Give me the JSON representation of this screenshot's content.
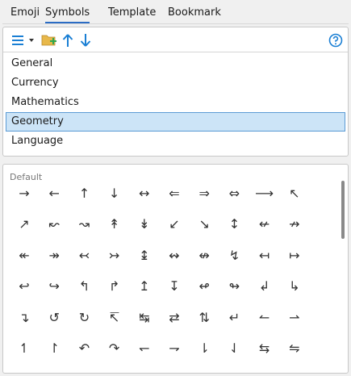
{
  "tabs": [
    {
      "label": "Emoji",
      "active": false
    },
    {
      "label": "Symbols",
      "active": true
    },
    {
      "label": "Template",
      "active": false
    },
    {
      "label": "Bookmark",
      "active": false
    }
  ],
  "toolbar": {
    "icons": [
      "list-menu-icon",
      "dropdown-arrow-icon",
      "add-folder-icon",
      "arrow-up-icon",
      "arrow-down-icon",
      "help-icon"
    ],
    "accent": "#1a7fd4",
    "folder_color": "#e8b84a",
    "plus_color": "#2fa84f"
  },
  "categories": [
    {
      "label": "General",
      "selected": false
    },
    {
      "label": "Currency",
      "selected": false
    },
    {
      "label": "Mathematics",
      "selected": false
    },
    {
      "label": "Geometry",
      "selected": true
    },
    {
      "label": "Language",
      "selected": false
    }
  ],
  "symbols_panel": {
    "section_title": "Default",
    "symbols": [
      "→",
      "←",
      "↑",
      "↓",
      "↔",
      "⇐",
      "⇒",
      "⇔",
      "⟶",
      "↖",
      "↗",
      "↜",
      "↝",
      "↟",
      "↡",
      "↙",
      "↘",
      "↕",
      "↚",
      "↛",
      "↞",
      "↠",
      "↢",
      "↣",
      "↨",
      "↭",
      "↮",
      "↯",
      "↤",
      "↦",
      "↩",
      "↪",
      "↰",
      "↱",
      "↥",
      "↧",
      "↫",
      "↬",
      "↲",
      "↳",
      "↴",
      "↺",
      "↻",
      "↸",
      "↹",
      "⇄",
      "⇅",
      "↵",
      "↼",
      "⇀",
      "↿",
      "↾",
      "↶",
      "↷",
      "↽",
      "⇁",
      "⇂",
      "⇃",
      "⇆",
      "⇋"
    ]
  }
}
